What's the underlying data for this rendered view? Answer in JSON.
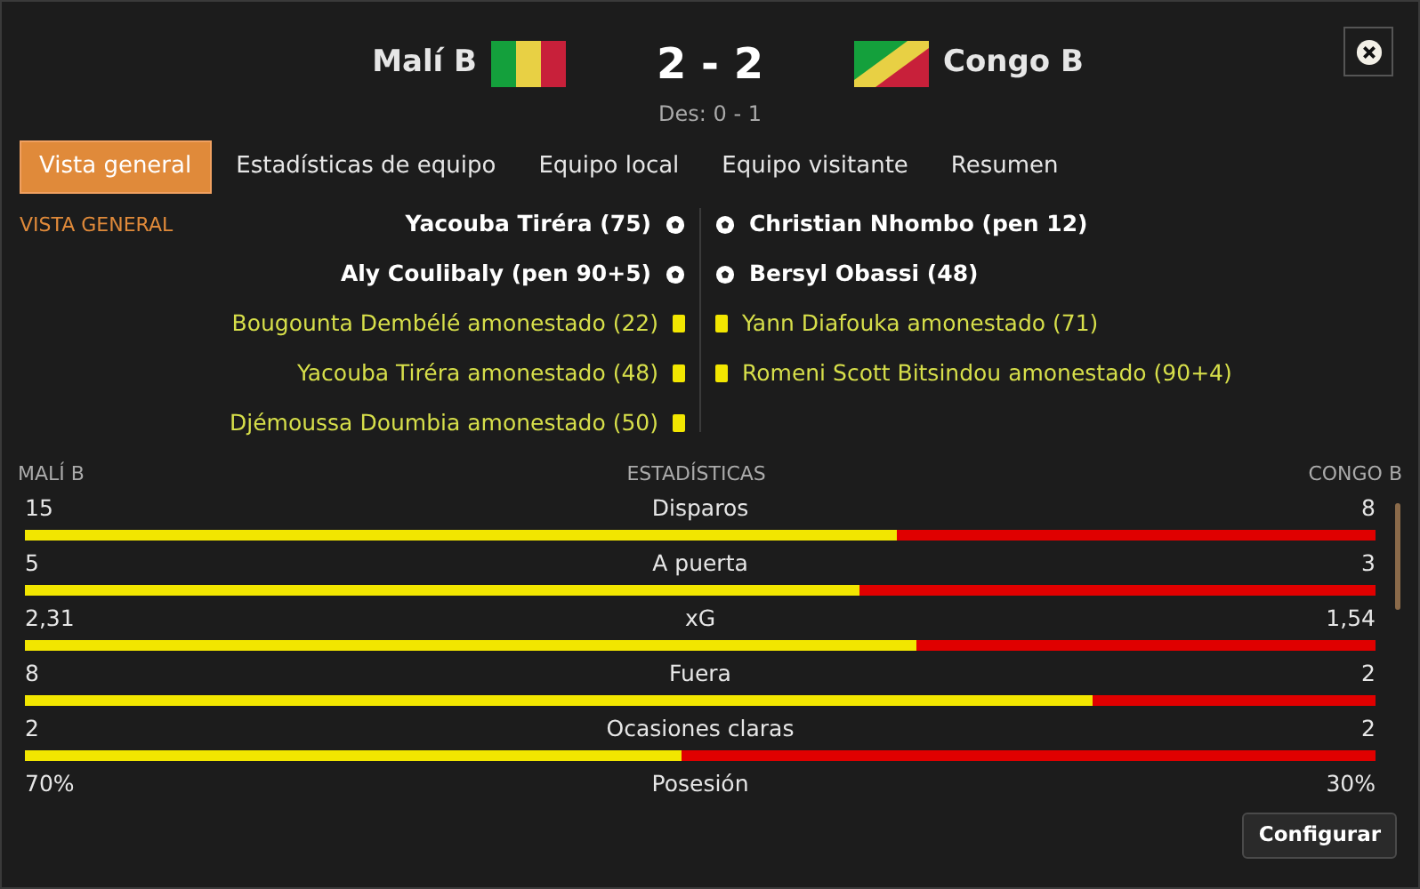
{
  "header": {
    "home_team": "Malí B",
    "away_team": "Congo B",
    "score": "2 - 2",
    "halftime": "Des: 0 - 1"
  },
  "tabs": [
    {
      "label": "Vista general",
      "selected": true
    },
    {
      "label": "Estadísticas de equipo",
      "selected": false
    },
    {
      "label": "Equipo local",
      "selected": false
    },
    {
      "label": "Equipo visitante",
      "selected": false
    },
    {
      "label": "Resumen",
      "selected": false
    }
  ],
  "section_title": "VISTA GENERAL",
  "home_events": [
    {
      "kind": "goal",
      "text": "Yacouba Tiréra (75)"
    },
    {
      "kind": "goal",
      "text": "Aly Coulibaly (pen 90+5)"
    },
    {
      "kind": "yellow_card",
      "text": "Bougounta Dembélé amonestado (22)"
    },
    {
      "kind": "yellow_card",
      "text": "Yacouba Tiréra amonestado (48)"
    },
    {
      "kind": "yellow_card",
      "text": "Djémoussa Doumbia amonestado (50)"
    }
  ],
  "away_events": [
    {
      "kind": "goal",
      "text": "Christian Nhombo (pen 12)"
    },
    {
      "kind": "goal",
      "text": "Bersyl Obassi (48)"
    },
    {
      "kind": "yellow_card",
      "text": "Yann Diafouka amonestado (71)"
    },
    {
      "kind": "yellow_card",
      "text": "Romeni Scott Bitsindou amonestado (90+4)"
    }
  ],
  "stats_header": {
    "home": "MALÍ B",
    "title": "ESTADÍSTICAS",
    "away": "CONGO B"
  },
  "stats": [
    {
      "label": "Disparos",
      "home": "15",
      "away": "8",
      "level": 0.645
    },
    {
      "label": "A puerta",
      "home": "5",
      "away": "3",
      "level": 0.618
    },
    {
      "label": "xG",
      "home": "2,31",
      "away": "1,54",
      "level": 0.66
    },
    {
      "label": "Fuera",
      "home": "8",
      "away": "2",
      "level": 0.79
    },
    {
      "label": "Ocasiones claras",
      "home": "2",
      "away": "2",
      "level": 0.486
    },
    {
      "label": "Posesión",
      "home": "70%",
      "away": "30%"
    }
  ],
  "configure_button": "Configurar"
}
